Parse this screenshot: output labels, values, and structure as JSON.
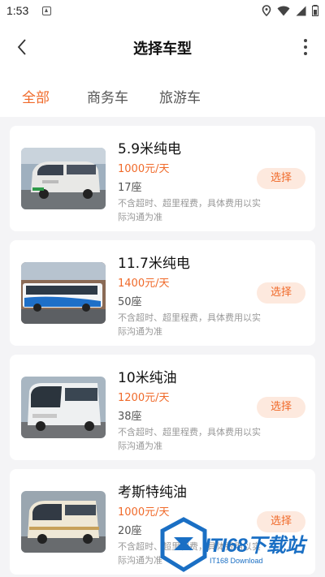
{
  "status_bar": {
    "time": "1:53"
  },
  "header": {
    "title": "选择车型"
  },
  "tabs": [
    {
      "label": "全部",
      "active": true
    },
    {
      "label": "商务车",
      "active": false
    },
    {
      "label": "旅游车",
      "active": false
    }
  ],
  "vehicles": [
    {
      "name": "5.9米纯电",
      "price": "1000元/天",
      "seats": "17座",
      "note": "不含超时、超里程费，具体费用以实际沟通为准",
      "button": "选择",
      "image": "white-minivan"
    },
    {
      "name": "11.7米纯电",
      "price": "1400元/天",
      "seats": "50座",
      "note": "不含超时、超里程费，具体费用以实际沟通为准",
      "button": "选择",
      "image": "blue-white-coach"
    },
    {
      "name": "10米纯油",
      "price": "1200元/天",
      "seats": "38座",
      "note": "不含超时、超里程费，具体费用以实际沟通为准",
      "button": "选择",
      "image": "white-coach"
    },
    {
      "name": "考斯特纯油",
      "price": "1000元/天",
      "seats": "20座",
      "note": "不含超时、超里程费，具体费用以实际沟通为准",
      "button": "选择",
      "image": "cream-minibus"
    }
  ],
  "watermark": {
    "title": "ITI68下载站",
    "subtitle": "IT168 Download"
  },
  "colors": {
    "accent": "#f06a2a",
    "accent_bg": "#fde9de",
    "background": "#f4f4f6",
    "watermark": "#1a6fc4"
  }
}
